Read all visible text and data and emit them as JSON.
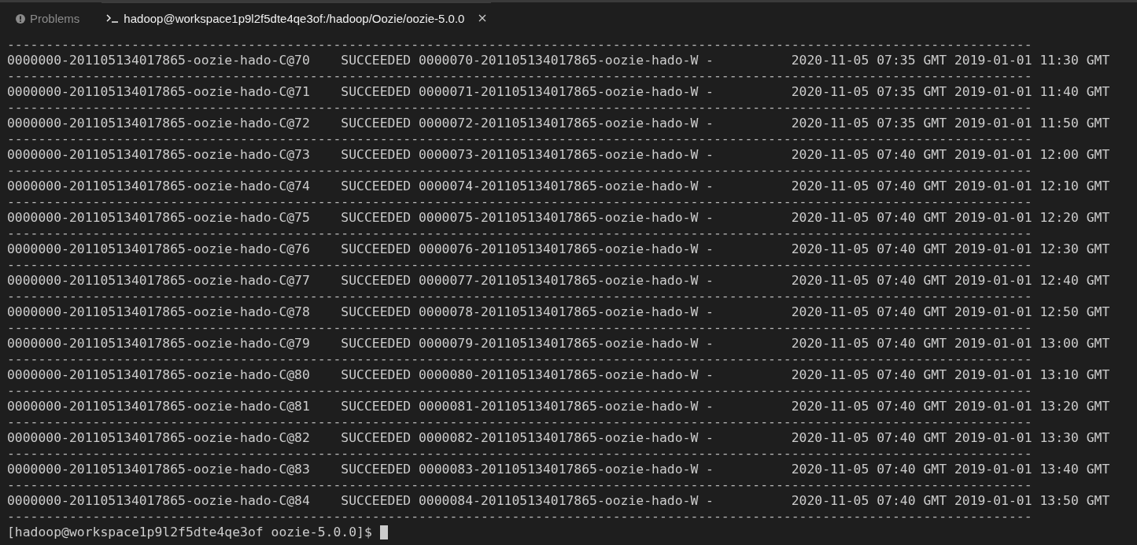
{
  "tabs": [
    {
      "kind": "problems",
      "label": "Problems",
      "selected": false
    },
    {
      "kind": "terminal",
      "label": "hadoop@workspace1p9l2f5dte4qe3of:/hadoop/Oozie/oozie-5.0.0",
      "selected": true
    }
  ],
  "terminal": {
    "lines": [
      {
        "kind": "rule",
        "text": "------------------------------------------------------------------------------------------------------------------------------------"
      },
      {
        "kind": "text",
        "text": "0000000-201105134017865-oozie-hado-C@70    SUCCEEDED 0000070-201105134017865-oozie-hado-W -          2020-11-05 07:35 GMT 2019-01-01 11:30 GMT"
      },
      {
        "kind": "rule",
        "text": "------------------------------------------------------------------------------------------------------------------------------------"
      },
      {
        "kind": "text",
        "text": "0000000-201105134017865-oozie-hado-C@71    SUCCEEDED 0000071-201105134017865-oozie-hado-W -          2020-11-05 07:35 GMT 2019-01-01 11:40 GMT"
      },
      {
        "kind": "rule",
        "text": "------------------------------------------------------------------------------------------------------------------------------------"
      },
      {
        "kind": "text",
        "text": "0000000-201105134017865-oozie-hado-C@72    SUCCEEDED 0000072-201105134017865-oozie-hado-W -          2020-11-05 07:35 GMT 2019-01-01 11:50 GMT"
      },
      {
        "kind": "rule",
        "text": "------------------------------------------------------------------------------------------------------------------------------------"
      },
      {
        "kind": "text",
        "text": "0000000-201105134017865-oozie-hado-C@73    SUCCEEDED 0000073-201105134017865-oozie-hado-W -          2020-11-05 07:40 GMT 2019-01-01 12:00 GMT"
      },
      {
        "kind": "rule",
        "text": "------------------------------------------------------------------------------------------------------------------------------------"
      },
      {
        "kind": "text",
        "text": "0000000-201105134017865-oozie-hado-C@74    SUCCEEDED 0000074-201105134017865-oozie-hado-W -          2020-11-05 07:40 GMT 2019-01-01 12:10 GMT"
      },
      {
        "kind": "rule",
        "text": "------------------------------------------------------------------------------------------------------------------------------------"
      },
      {
        "kind": "text",
        "text": "0000000-201105134017865-oozie-hado-C@75    SUCCEEDED 0000075-201105134017865-oozie-hado-W -          2020-11-05 07:40 GMT 2019-01-01 12:20 GMT"
      },
      {
        "kind": "rule",
        "text": "------------------------------------------------------------------------------------------------------------------------------------"
      },
      {
        "kind": "text",
        "text": "0000000-201105134017865-oozie-hado-C@76    SUCCEEDED 0000076-201105134017865-oozie-hado-W -          2020-11-05 07:40 GMT 2019-01-01 12:30 GMT"
      },
      {
        "kind": "rule",
        "text": "------------------------------------------------------------------------------------------------------------------------------------"
      },
      {
        "kind": "text",
        "text": "0000000-201105134017865-oozie-hado-C@77    SUCCEEDED 0000077-201105134017865-oozie-hado-W -          2020-11-05 07:40 GMT 2019-01-01 12:40 GMT"
      },
      {
        "kind": "rule",
        "text": "------------------------------------------------------------------------------------------------------------------------------------"
      },
      {
        "kind": "text",
        "text": "0000000-201105134017865-oozie-hado-C@78    SUCCEEDED 0000078-201105134017865-oozie-hado-W -          2020-11-05 07:40 GMT 2019-01-01 12:50 GMT"
      },
      {
        "kind": "rule",
        "text": "------------------------------------------------------------------------------------------------------------------------------------"
      },
      {
        "kind": "text",
        "text": "0000000-201105134017865-oozie-hado-C@79    SUCCEEDED 0000079-201105134017865-oozie-hado-W -          2020-11-05 07:40 GMT 2019-01-01 13:00 GMT"
      },
      {
        "kind": "rule",
        "text": "------------------------------------------------------------------------------------------------------------------------------------"
      },
      {
        "kind": "text",
        "text": "0000000-201105134017865-oozie-hado-C@80    SUCCEEDED 0000080-201105134017865-oozie-hado-W -          2020-11-05 07:40 GMT 2019-01-01 13:10 GMT"
      },
      {
        "kind": "rule",
        "text": "------------------------------------------------------------------------------------------------------------------------------------"
      },
      {
        "kind": "text",
        "text": "0000000-201105134017865-oozie-hado-C@81    SUCCEEDED 0000081-201105134017865-oozie-hado-W -          2020-11-05 07:40 GMT 2019-01-01 13:20 GMT"
      },
      {
        "kind": "rule",
        "text": "------------------------------------------------------------------------------------------------------------------------------------"
      },
      {
        "kind": "text",
        "text": "0000000-201105134017865-oozie-hado-C@82    SUCCEEDED 0000082-201105134017865-oozie-hado-W -          2020-11-05 07:40 GMT 2019-01-01 13:30 GMT"
      },
      {
        "kind": "rule",
        "text": "------------------------------------------------------------------------------------------------------------------------------------"
      },
      {
        "kind": "text",
        "text": "0000000-201105134017865-oozie-hado-C@83    SUCCEEDED 0000083-201105134017865-oozie-hado-W -          2020-11-05 07:40 GMT 2019-01-01 13:40 GMT"
      },
      {
        "kind": "rule",
        "text": "------------------------------------------------------------------------------------------------------------------------------------"
      },
      {
        "kind": "text",
        "text": "0000000-201105134017865-oozie-hado-C@84    SUCCEEDED 0000084-201105134017865-oozie-hado-W -          2020-11-05 07:40 GMT 2019-01-01 13:50 GMT"
      },
      {
        "kind": "rule",
        "text": "------------------------------------------------------------------------------------------------------------------------------------"
      }
    ],
    "prompt": "[hadoop@workspace1p9l2f5dte4qe3of oozie-5.0.0]$"
  }
}
